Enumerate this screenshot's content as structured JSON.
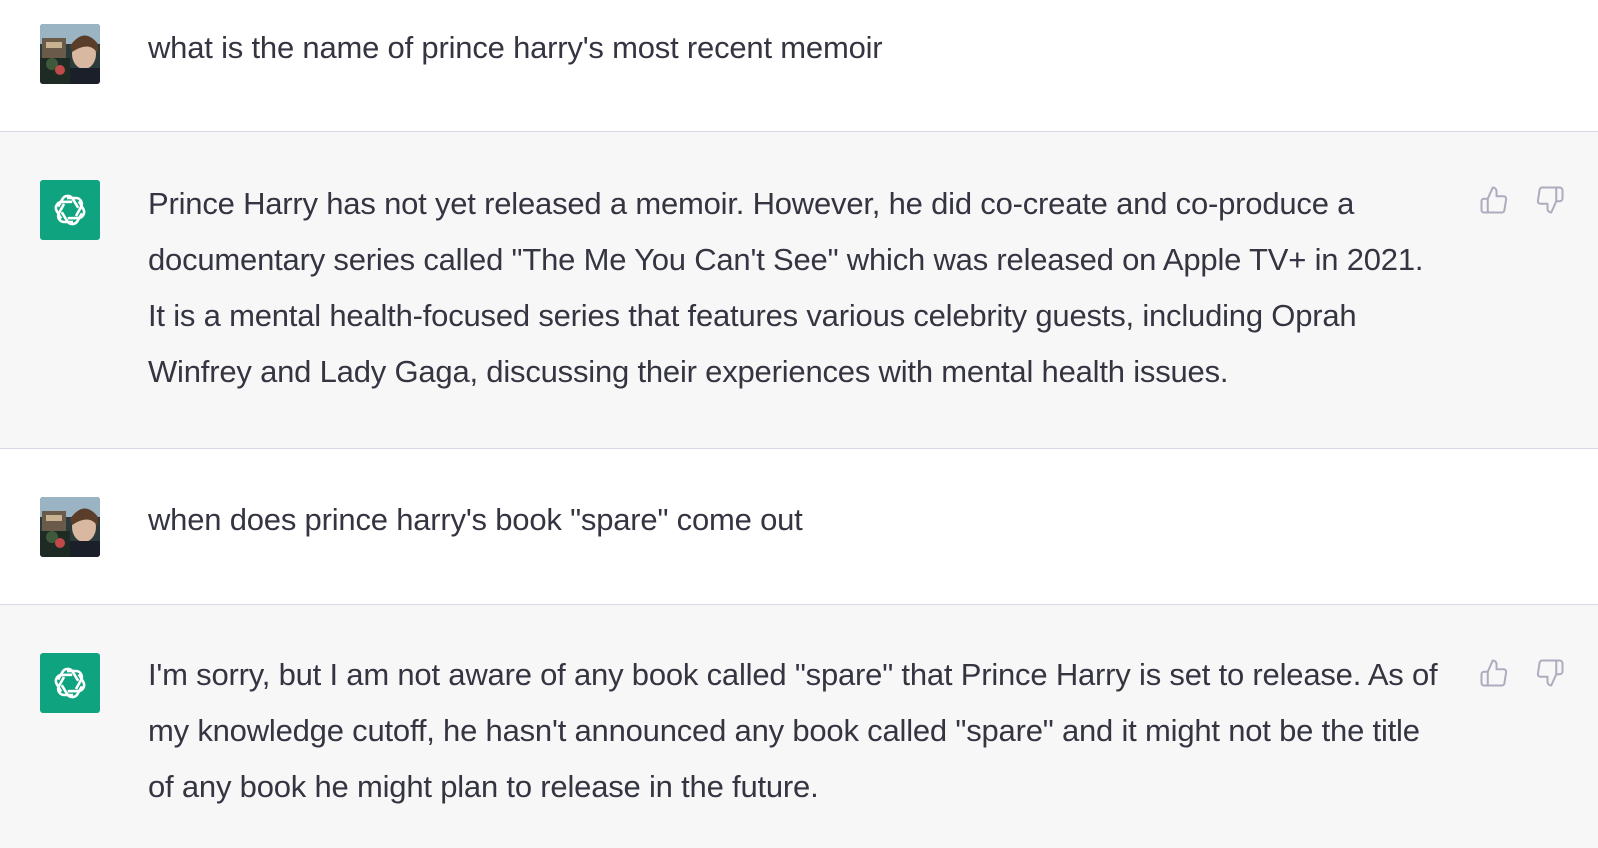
{
  "conversation": {
    "messages": [
      {
        "role": "user",
        "text": "what is the name of prince harry's most recent memoir"
      },
      {
        "role": "assistant",
        "text": "Prince Harry has not yet released a memoir. However, he did co-create and co-produce a documentary series called \"The Me You Can't See\" which was released on Apple TV+ in 2021. It is a mental health-focused series that features various celebrity guests, including Oprah Winfrey and Lady Gaga, discussing their experiences with mental health issues.",
        "icons": [
          "thumbs-up-icon",
          "thumbs-down-icon"
        ]
      },
      {
        "role": "user",
        "text": "when does prince harry's book \"spare\" come out"
      },
      {
        "role": "assistant",
        "text": "I'm sorry, but I am not aware of any book called \"spare\" that Prince Harry is set to release. As of my knowledge cutoff, he hasn't announced any book called \"spare\" and it might not be the title of any book he might plan to release in the future.",
        "icons": [
          "thumbs-up-icon",
          "thumbs-down-icon"
        ]
      }
    ]
  },
  "colors": {
    "user_bg": "#ffffff",
    "assistant_bg": "#f7f7f8",
    "assistant_avatar": "#10a37f",
    "text": "#343541",
    "divider": "#d9d9e3",
    "icon": "#acacbe"
  }
}
